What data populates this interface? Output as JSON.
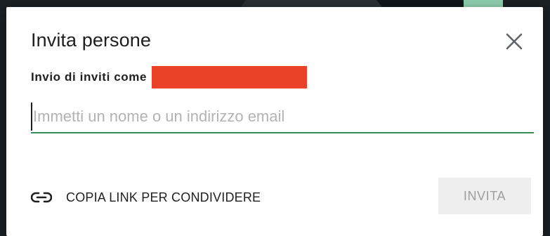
{
  "dialog": {
    "title": "Invita persone",
    "close_icon": "close-icon",
    "sender_label": "Invio di inviti come",
    "sender_value_redacted": true,
    "redaction_color": "#ea4129",
    "email_input": {
      "value": "",
      "placeholder": "Immetti un nome o un indirizzo email"
    },
    "focus_underline_color": "#3c8c55",
    "copy_link": {
      "icon": "link-icon",
      "label": "COPIA LINK PER CONDIVIDERE"
    },
    "invite_button": {
      "label": "INVITA",
      "disabled": true
    }
  }
}
